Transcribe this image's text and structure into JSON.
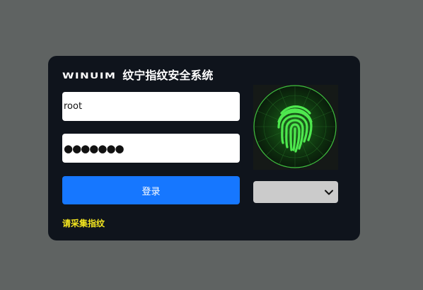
{
  "header": {
    "logo": "WINUIM",
    "title": "纹宁指纹安全系统"
  },
  "login": {
    "username": "root",
    "password": "●●●●●●●",
    "submit_label": "登录",
    "hint": "请采集指纹"
  },
  "fingerprint": {
    "icon": "fingerprint-icon",
    "accent_color": "#4ee84e"
  },
  "device": {
    "selected": "",
    "icon": "chevron-down-icon"
  }
}
